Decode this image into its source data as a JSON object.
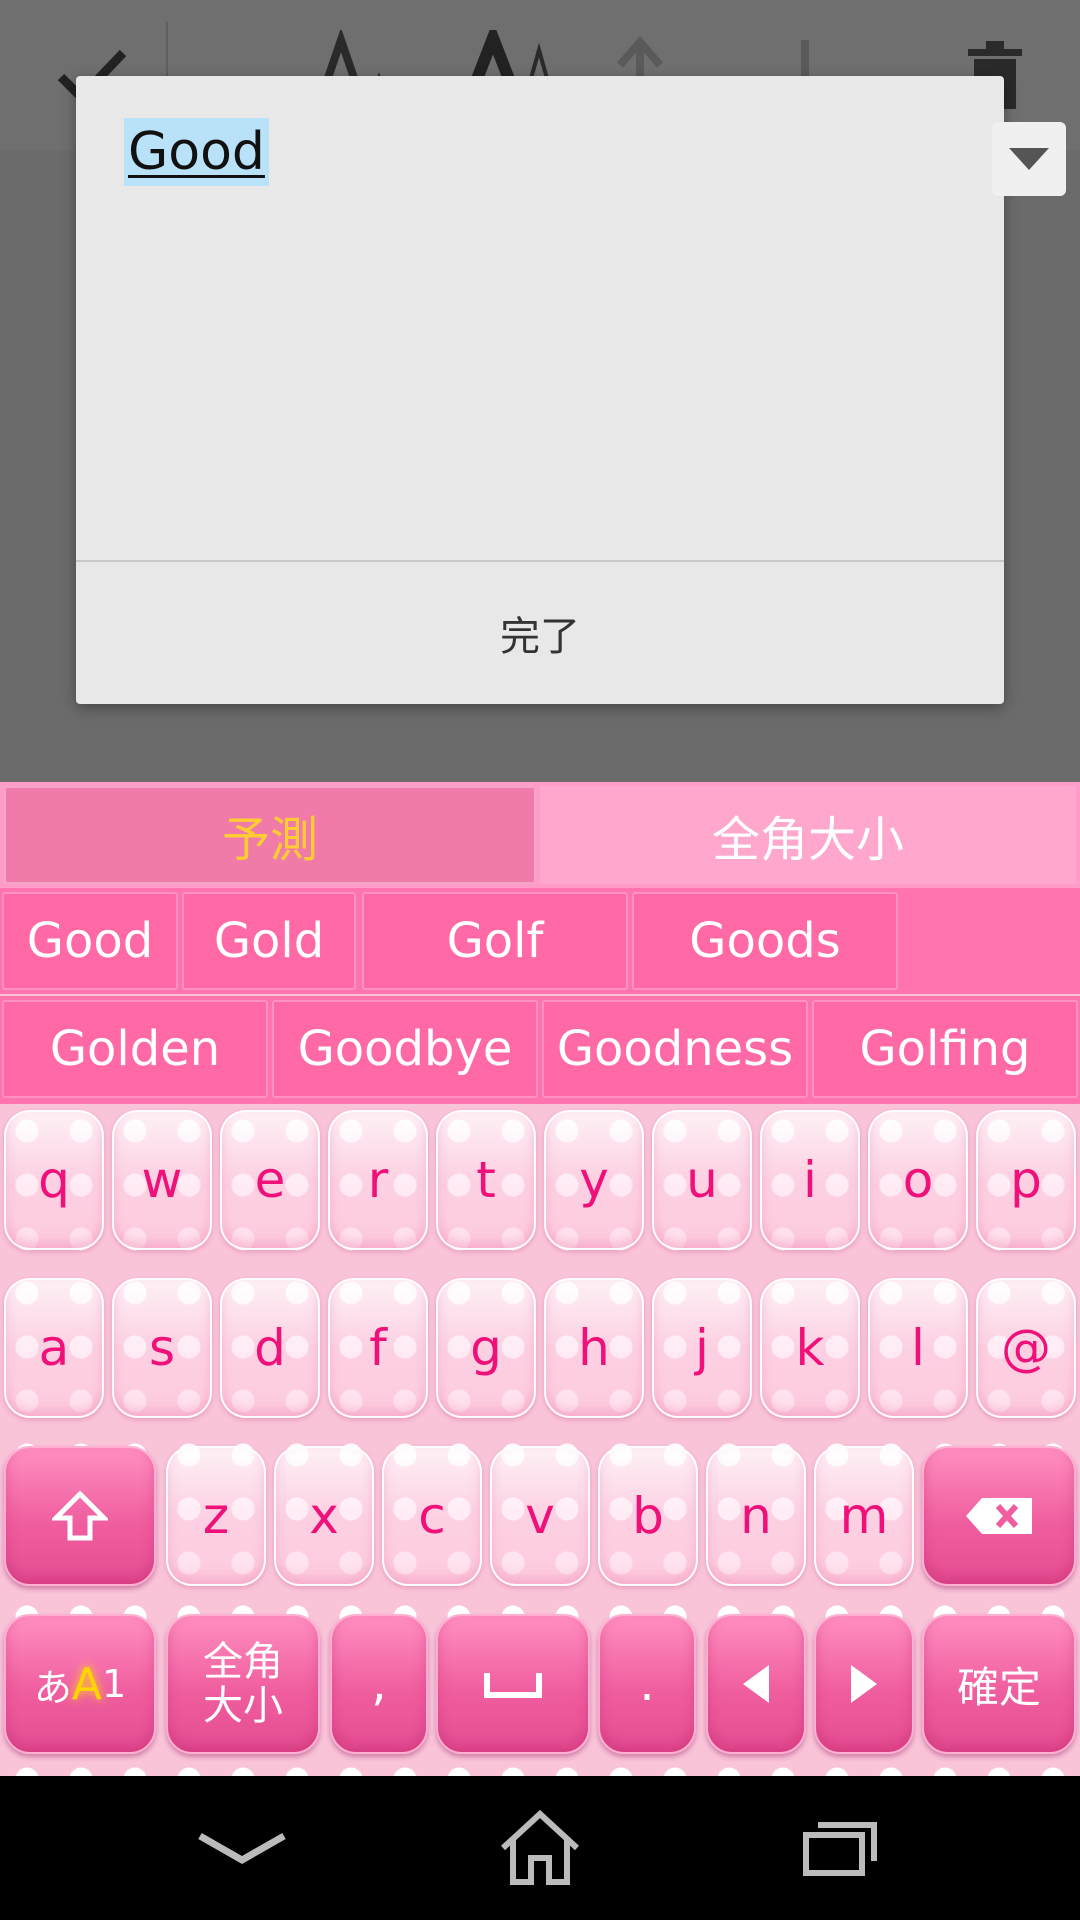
{
  "dialog": {
    "input_text": "Good",
    "done_label": "完了"
  },
  "keyboard": {
    "tabs": {
      "prediction": "予測",
      "fullwidth_case": "全角大小"
    },
    "candidates_row1": [
      "Good",
      "Gold",
      "Golf",
      "Goods"
    ],
    "candidates_row2": [
      "Golden",
      "Goodbye",
      "Goodness",
      "Golfing"
    ],
    "rows": {
      "r1": [
        "q",
        "w",
        "e",
        "r",
        "t",
        "y",
        "u",
        "i",
        "o",
        "p"
      ],
      "r2": [
        "a",
        "s",
        "d",
        "f",
        "g",
        "h",
        "j",
        "k",
        "l",
        "@"
      ],
      "r3": [
        "z",
        "x",
        "c",
        "v",
        "b",
        "n",
        "m"
      ]
    },
    "mode_key": {
      "hira": "あ",
      "alpha": "A",
      "num": "1"
    },
    "fullwidth_key": {
      "line1": "全角",
      "line2": "大小"
    },
    "comma": ",",
    "period": ".",
    "confirm": "確定"
  },
  "colors": {
    "accent_pink": "#f0107a",
    "active_tab_text": "#ffcc33"
  },
  "icons": [
    "check-icon",
    "font-small-icon",
    "font-large-icon",
    "move-up-icon",
    "move-down-icon",
    "trash-icon",
    "chevron-down-icon",
    "shift-icon",
    "backspace-icon",
    "space-icon",
    "arrow-left-icon",
    "arrow-right-icon",
    "nav-back-icon",
    "nav-home-icon",
    "nav-recents-icon"
  ]
}
